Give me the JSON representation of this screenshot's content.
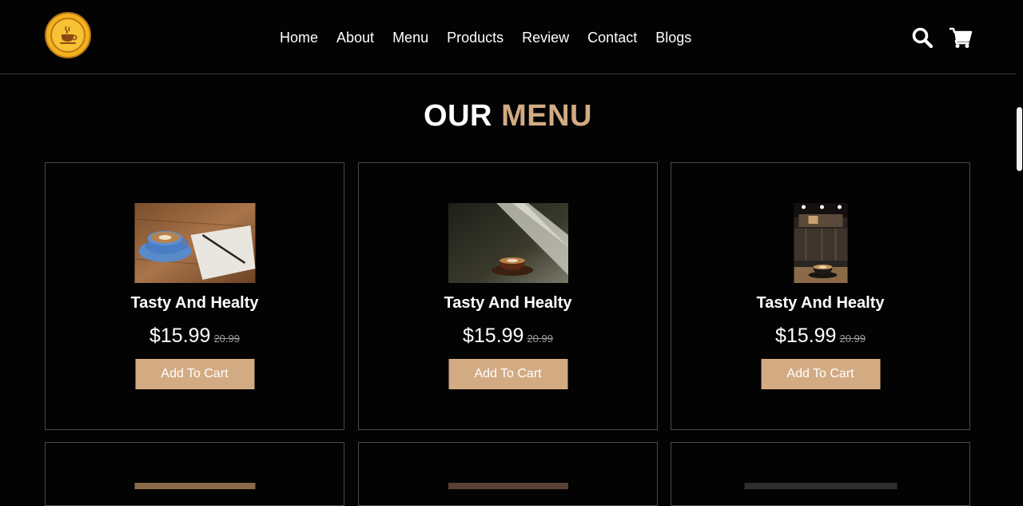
{
  "nav": {
    "items": [
      "Home",
      "About",
      "Menu",
      "Products",
      "Review",
      "Contact",
      "Blogs"
    ]
  },
  "header": {
    "logo_icon": "coffee-cup-logo",
    "search_icon": "search-icon",
    "cart_icon": "cart-icon"
  },
  "section": {
    "title_part1": "OUR",
    "title_part2": "MENU"
  },
  "cards": [
    {
      "title": "Tasty And Healty",
      "price": "$15.99",
      "old_price": "20.99",
      "button": "Add To Cart"
    },
    {
      "title": "Tasty And Healty",
      "price": "$15.99",
      "old_price": "20.99",
      "button": "Add To Cart"
    },
    {
      "title": "Tasty And Healty",
      "price": "$15.99",
      "old_price": "20.99",
      "button": "Add To Cart"
    }
  ],
  "colors": {
    "background": "#030304",
    "accent": "#d3ab83",
    "logo": "#f3b11c"
  }
}
